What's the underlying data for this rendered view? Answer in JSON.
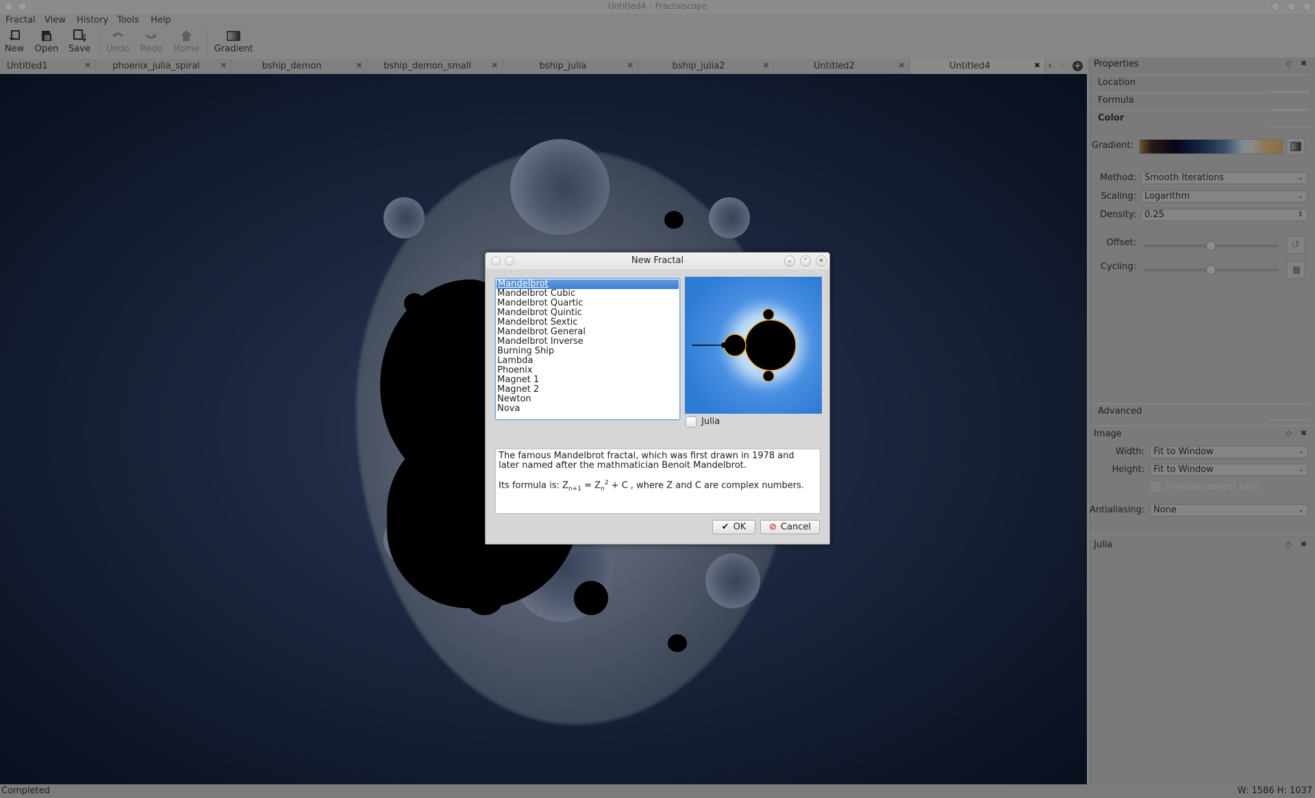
{
  "window": {
    "title": "Untitled4 – Fractalscope"
  },
  "menu": [
    "Fractal",
    "View",
    "History",
    "Tools",
    "Help"
  ],
  "toolbar": {
    "new": "New",
    "open": "Open",
    "save": "Save",
    "undo": "Undo",
    "redo": "Redo",
    "home": "Home",
    "gradient": "Gradient"
  },
  "tabs": [
    {
      "label": "Untitled1",
      "active": false
    },
    {
      "label": "phoenix_julia_spiral",
      "active": false
    },
    {
      "label": "bship_demon",
      "active": false
    },
    {
      "label": "bship_demon_small",
      "active": false
    },
    {
      "label": "bship_julia",
      "active": false
    },
    {
      "label": "bship_julia2",
      "active": false
    },
    {
      "label": "Untitled2",
      "active": false
    },
    {
      "label": "Untitled4",
      "active": true
    }
  ],
  "properties": {
    "title": "Properties",
    "sections": {
      "location": "Location",
      "formula": "Formula",
      "color": "Color",
      "advanced": "Advanced"
    },
    "gradient_label": "Gradient:",
    "method_label": "Method:",
    "method_value": "Smooth Iterations",
    "scaling_label": "Scaling:",
    "scaling_value": "Logarithm",
    "density_label": "Density:",
    "density_value": "0.25",
    "offset_label": "Offset:",
    "offset_value": 0.5,
    "cycling_label": "Cycling:",
    "cycling_value": 0.5
  },
  "image_panel": {
    "title": "Image",
    "width_label": "Width:",
    "width_value": "Fit to Window",
    "height_label": "Height:",
    "height_value": "Fit to Window",
    "aspect_label": "Maintain aspect ratio",
    "aspect_checked": true,
    "antialiasing_label": "Antialiasing:",
    "antialiasing_value": "None"
  },
  "julia_panel": {
    "title": "Julia"
  },
  "status": {
    "left": "Completed",
    "right": "W: 1586  H: 1037"
  },
  "dialog": {
    "title": "New Fractal",
    "fractal_types": [
      "Mandelbrot",
      "Mandelbrot Cubic",
      "Mandelbrot Quartic",
      "Mandelbrot Quintic",
      "Mandelbrot Sextic",
      "Mandelbrot General",
      "Mandelbrot Inverse",
      "Burning Ship",
      "Lambda",
      "Phoenix",
      "Magnet 1",
      "Magnet 2",
      "Newton",
      "Nova"
    ],
    "selected_index": 0,
    "julia_label": "Julia",
    "julia_checked": false,
    "description_line1": "The famous Mandelbrot fractal, which was first drawn in 1978 and later named after the mathmatician Benoit Mandelbrot.",
    "formula_prefix": "Its formula is: ",
    "formula_suffix": " , where Z and C are complex numbers.",
    "ok_label": "OK",
    "cancel_label": "Cancel"
  },
  "icons": {
    "ok": "✔",
    "cancel": "⊘",
    "close": "✖",
    "float": "◇",
    "chevron_down": "⌄",
    "spin": "⇕"
  }
}
